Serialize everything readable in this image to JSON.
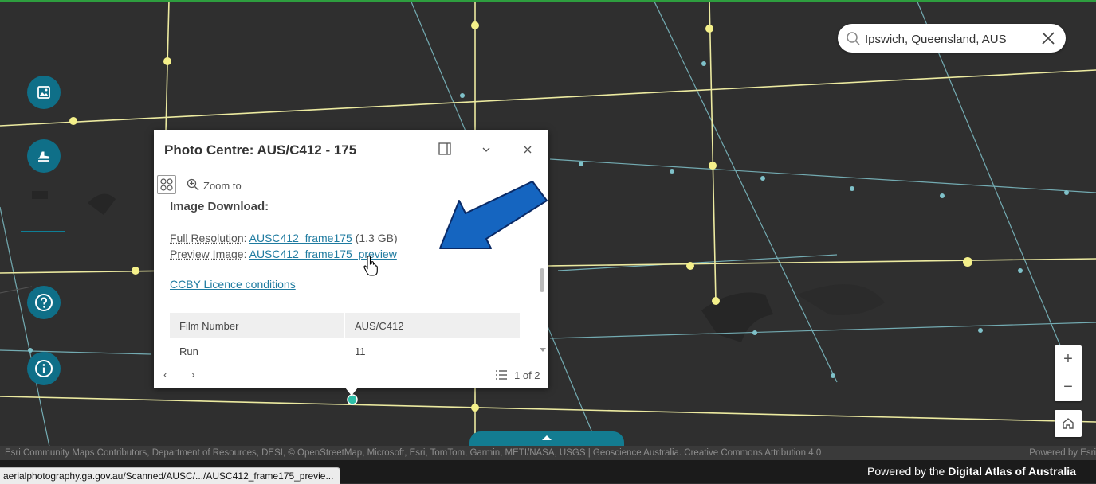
{
  "search": {
    "value": "Ipswich, Queensland, AUS"
  },
  "popup": {
    "title": "Photo Centre: AUS/C412 - 175",
    "zoom_to": "Zoom to",
    "section_heading": "Image Download:",
    "full_res_label": "Full Resolution",
    "full_res_link": "AUSC412_frame175",
    "full_res_size": "(1.3 GB)",
    "preview_label": "Preview Image",
    "preview_link": "AUSC412_frame175_preview",
    "licence_link": "CCBY Licence conditions",
    "table": [
      {
        "key": "Film Number",
        "value": "AUS/C412"
      },
      {
        "key": "Run",
        "value": "11"
      }
    ],
    "pagination": "1 of 2"
  },
  "attribution": {
    "text": "Esri Community Maps Contributors, Department of Resources, DESI, © OpenStreetMap, Microsoft, Esri, TomTom, Garmin, METI/NASA, USGS | Geoscience Australia. Creative Commons Attribution 4.0",
    "powered": "Powered by Esri"
  },
  "footer": {
    "prefix": "Powered by the",
    "brand": "Digital Atlas of Australia"
  },
  "status_url": "aerialphotography.ga.gov.au/Scanned/AUSC/.../AUSC412_frame175_previe...",
  "colors": {
    "map_bg": "#2f2f2f",
    "accent": "#0f6f88",
    "link": "#1f7ba0",
    "flight_line": "#f2f0a0",
    "road_line": "#7fc1c9",
    "arrow": "#1565c0"
  },
  "icons": [
    "image-icon",
    "plane-icon",
    "help-icon",
    "info-icon",
    "search-icon",
    "close-icon",
    "home-icon"
  ]
}
